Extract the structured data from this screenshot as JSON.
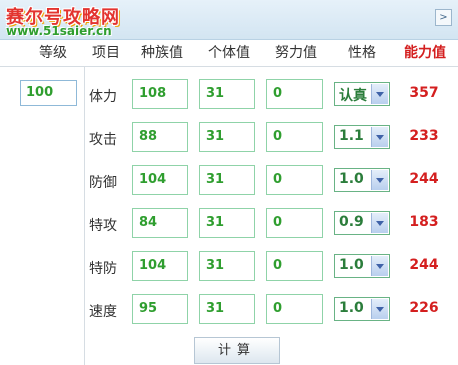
{
  "brand": {
    "title": "赛尔号攻略网",
    "url": "www.51saier.cn",
    "close_glyph": ">"
  },
  "headers": {
    "level": "等级",
    "item": "项目",
    "base": "种族值",
    "iv": "个体值",
    "ev": "努力值",
    "nature": "性格",
    "power": "能力值"
  },
  "level_value": "100",
  "rows": [
    {
      "label": "体力",
      "base": "108",
      "iv": "31",
      "ev": "0",
      "nature": "认真",
      "power": "357"
    },
    {
      "label": "攻击",
      "base": "88",
      "iv": "31",
      "ev": "0",
      "nature": "1.1",
      "power": "233"
    },
    {
      "label": "防御",
      "base": "104",
      "iv": "31",
      "ev": "0",
      "nature": "1.0",
      "power": "244"
    },
    {
      "label": "特攻",
      "base": "84",
      "iv": "31",
      "ev": "0",
      "nature": "0.9",
      "power": "183"
    },
    {
      "label": "特防",
      "base": "104",
      "iv": "31",
      "ev": "0",
      "nature": "1.0",
      "power": "244"
    },
    {
      "label": "速度",
      "base": "95",
      "iv": "31",
      "ev": "0",
      "nature": "1.0",
      "power": "226"
    }
  ],
  "calc_button": "计算",
  "colors": {
    "power_text": "#d41f1f",
    "input_text": "#2f9e2f",
    "input_border": "#8fd3a8"
  }
}
